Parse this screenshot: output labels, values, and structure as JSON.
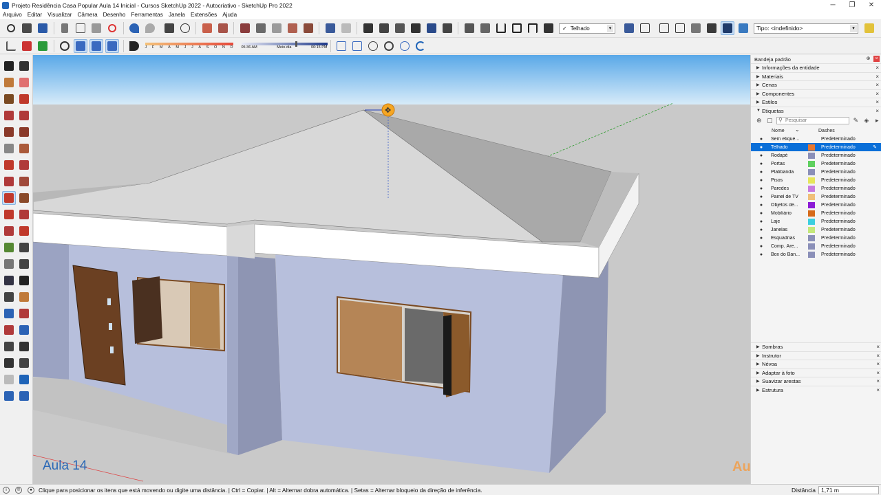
{
  "window": {
    "title": "Projeto Residência Casa Popular Aula 14 Inicial - Cursos SketchUp 2022 - Autocriativo - SketchUp Pro 2022",
    "minimize": "─",
    "maximize": "❐",
    "close": "✕"
  },
  "menu": [
    "Arquivo",
    "Editar",
    "Visualizar",
    "Câmera",
    "Desenho",
    "Ferramentas",
    "Janela",
    "Extensões",
    "Ajuda"
  ],
  "toolbar": {
    "active_tag": "Telhado",
    "active_tag_check": "✓",
    "type_label": "Tipo: <indefinido>",
    "months": [
      "J",
      "F",
      "M",
      "A",
      "M",
      "J",
      "J",
      "A",
      "S",
      "O",
      "N",
      "D"
    ],
    "sun_start": "05:36 AM",
    "sun_mid": "Meio-dia",
    "sun_end": "06:15 PM"
  },
  "viewport": {
    "lesson_label": "Aula 14",
    "watermark": "Autocriativo"
  },
  "tray": {
    "title": "Bandeja padrão",
    "panels_top": [
      "Informações da entidade",
      "Materiais",
      "Cenas",
      "Componentes",
      "Estilos"
    ],
    "tags_panel": {
      "title": "Etiquetas",
      "search_placeholder": "Pesquisar",
      "col_name": "Nome",
      "col_dashes": "Dashes",
      "rows": [
        {
          "name": "Sem etique...",
          "color": "",
          "dashes": "Predeterminado"
        },
        {
          "name": "Telhado",
          "color": "#e8772e",
          "dashes": "Predeterminado"
        },
        {
          "name": "Rodapé",
          "color": "#8a8fb8",
          "dashes": "Predeterminado"
        },
        {
          "name": "Portas",
          "color": "#5fd05f",
          "dashes": "Predeterminado"
        },
        {
          "name": "Platibanda",
          "color": "#8a8fb8",
          "dashes": "Predeterminado"
        },
        {
          "name": "Pisos",
          "color": "#e6e65a",
          "dashes": "Predeterminado"
        },
        {
          "name": "Paredes",
          "color": "#c77be0",
          "dashes": "Predeterminado"
        },
        {
          "name": "Painel de TV",
          "color": "#f0c07a",
          "dashes": "Predeterminado"
        },
        {
          "name": "Objetos de...",
          "color": "#8b1ad6",
          "dashes": "Predeterminado"
        },
        {
          "name": "Mobiliário",
          "color": "#d66a1a",
          "dashes": "Predeterminado"
        },
        {
          "name": "Laje",
          "color": "#3ccfe0",
          "dashes": "Predeterminado"
        },
        {
          "name": "Janelas",
          "color": "#c4e87a",
          "dashes": "Predeterminado"
        },
        {
          "name": "Esquadrias",
          "color": "#8a8fb8",
          "dashes": "Predeterminado"
        },
        {
          "name": "Comp. Áre...",
          "color": "#8a8fb8",
          "dashes": "Predeterminado"
        },
        {
          "name": "Box do Ban...",
          "color": "#8a8fb8",
          "dashes": "Predeterminado"
        }
      ]
    },
    "panels_bottom": [
      "Sombras",
      "Instrutor",
      "Névoa",
      "Adaptar à foto",
      "Suavizar arestas",
      "Estrutura"
    ]
  },
  "status": {
    "message": "Clique para posicionar os itens que está movendo ou digite uma distância. | Ctrl = Copiar. | Alt = Alternar dobra automática. | Setas = Alternar bloqueio da direção de inferência.",
    "distance_label": "Distância",
    "distance_value": "1,71 m"
  },
  "colors": {
    "sky_top": "#5aa9e8",
    "sky_bottom": "#cfe6f8",
    "ground": "#c9c9c9",
    "wall": "#b7bfdc",
    "roof": "#d8d8d8",
    "selection": "#0a6fd8",
    "wood": "#a26a3a"
  }
}
